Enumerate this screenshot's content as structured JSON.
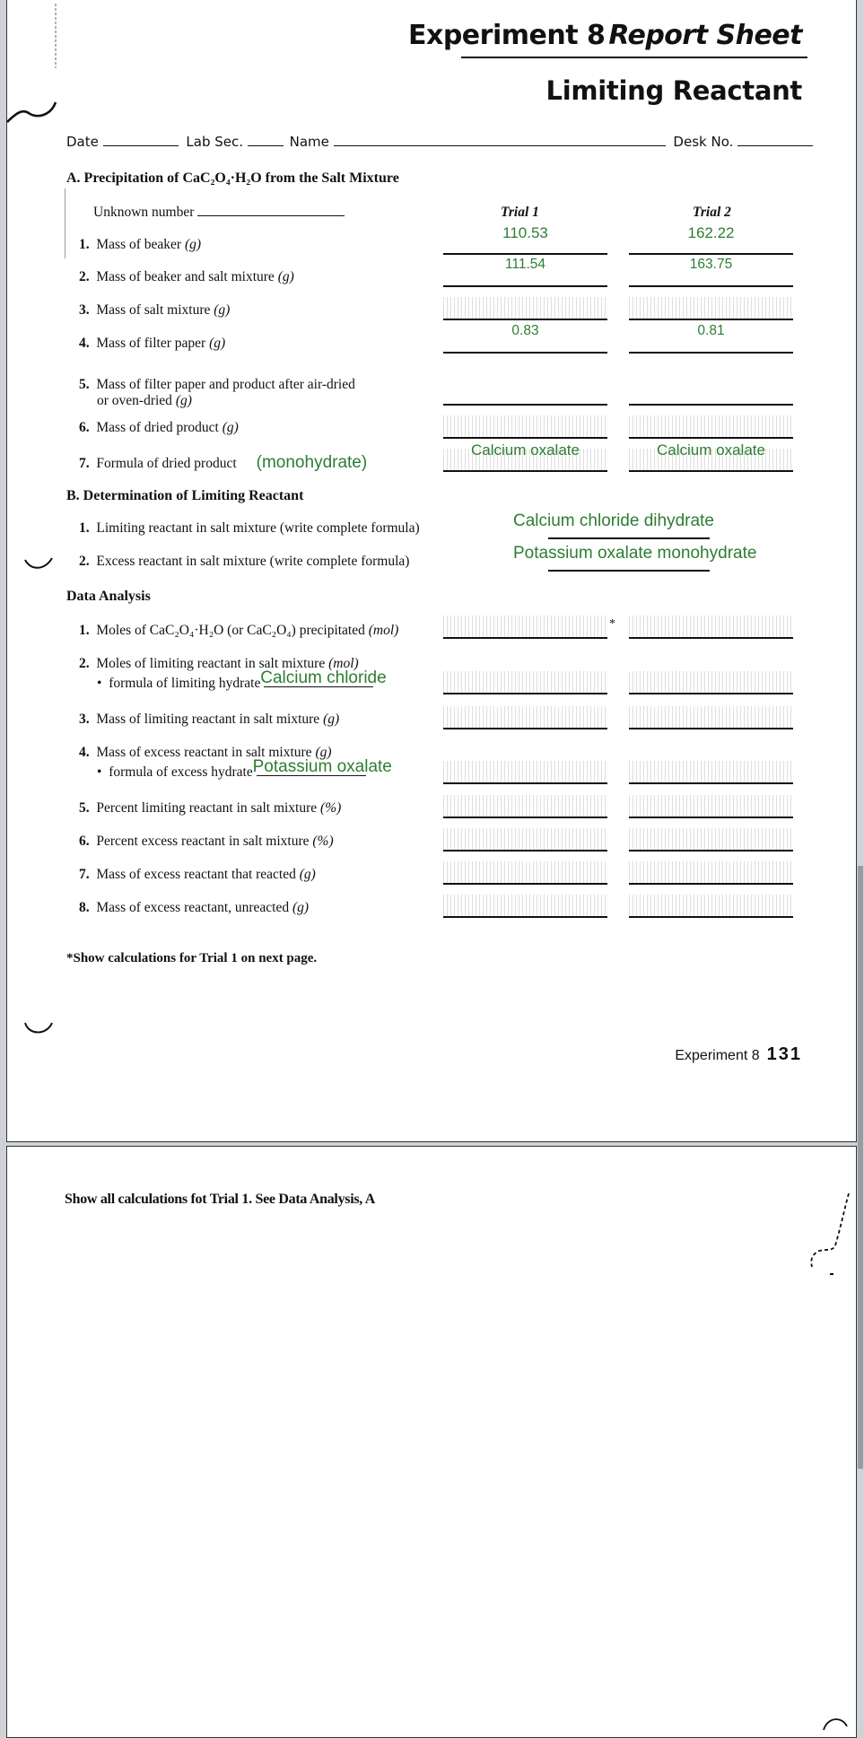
{
  "header": {
    "title_experiment": "Experiment",
    "title_number": "8",
    "title_report": "Report Sheet",
    "subtitle": "Limiting Reactant",
    "fields": {
      "date_label": "Date",
      "lab_sec_label": "Lab Sec.",
      "name_label": "Name",
      "desk_no_label": "Desk No."
    }
  },
  "section_a": {
    "title": "A.  Precipitation of CaC₂O₄·H₂O from the Salt Mixture",
    "unknown_label": "Unknown number",
    "trial1_header": "Trial 1",
    "trial2_header": "Trial 2",
    "rows": [
      {
        "num": "1.",
        "label": "Mass of beaker",
        "unit": "(g)",
        "trial1": "110.53",
        "trial2": "162.22"
      },
      {
        "num": "2.",
        "label": "Mass of beaker and salt mixture",
        "unit": "(g)",
        "trial1": "111.54",
        "trial2": "163.75"
      },
      {
        "num": "3.",
        "label": "Mass of salt mixture",
        "unit": "(g)",
        "trial1": "",
        "trial2": ""
      },
      {
        "num": "4.",
        "label": "Mass of filter paper",
        "unit": "(g)",
        "trial1": "0.83",
        "trial2": "0.81"
      },
      {
        "num": "5.",
        "label": "Mass of filter paper and product after air-dried",
        "label2": "or oven-dried",
        "unit": "(g)",
        "trial1": "",
        "trial2": ""
      },
      {
        "num": "6.",
        "label": "Mass of dried product",
        "unit": "(g)",
        "trial1": "",
        "trial2": ""
      },
      {
        "num": "7.",
        "label": "Formula of dried product",
        "note": "(monohydrate)",
        "trial1": "Calcium oxalate",
        "trial2": "Calcium oxalate"
      }
    ]
  },
  "section_b": {
    "title": "B.  Determination of Limiting Reactant",
    "rows": [
      {
        "num": "1.",
        "label": "Limiting reactant in salt mixture (write complete formula)",
        "answer": "Calcium chloride dihydrate"
      },
      {
        "num": "2.",
        "label": "Excess reactant in salt mixture (write complete formula)",
        "answer": "Potassium oxalate monohydrate"
      }
    ]
  },
  "data_analysis": {
    "title": "Data Analysis",
    "rows": [
      {
        "num": "1.",
        "label": "Moles of CaC₂O₄·H₂O (or CaC₂O₄) precipitated",
        "unit": "(mol)",
        "asterisk": "*"
      },
      {
        "num": "2.",
        "label": "Moles of limiting reactant in salt mixture",
        "unit": "(mol)",
        "sub_label": "formula of limiting hydrate",
        "sub_answer": "Calcium chloride"
      },
      {
        "num": "3.",
        "label": "Mass of limiting reactant in salt mixture",
        "unit": "(g)"
      },
      {
        "num": "4.",
        "label": "Mass of excess reactant in salt mixture",
        "unit": "(g)",
        "sub_label": "formula of excess hydrate",
        "sub_answer": "Potassium oxalate"
      },
      {
        "num": "5.",
        "label": "Percent limiting reactant in salt mixture",
        "unit": "(%)"
      },
      {
        "num": "6.",
        "label": "Percent excess reactant in salt mixture",
        "unit": "(%)"
      },
      {
        "num": "7.",
        "label": "Mass of excess reactant that reacted",
        "unit": "(g)"
      },
      {
        "num": "8.",
        "label": "Mass of excess reactant, unreacted",
        "unit": "(g)"
      }
    ],
    "footnote": "*Show calculations for Trial 1 on next page."
  },
  "footer": {
    "experiment_label": "Experiment 8",
    "page_number": "131"
  },
  "page2": {
    "instruction": "Show all calculations fot Trial 1. See Data Analysis, A"
  },
  "colors": {
    "handwriting": "#2e7d32",
    "ink": "#111111"
  }
}
